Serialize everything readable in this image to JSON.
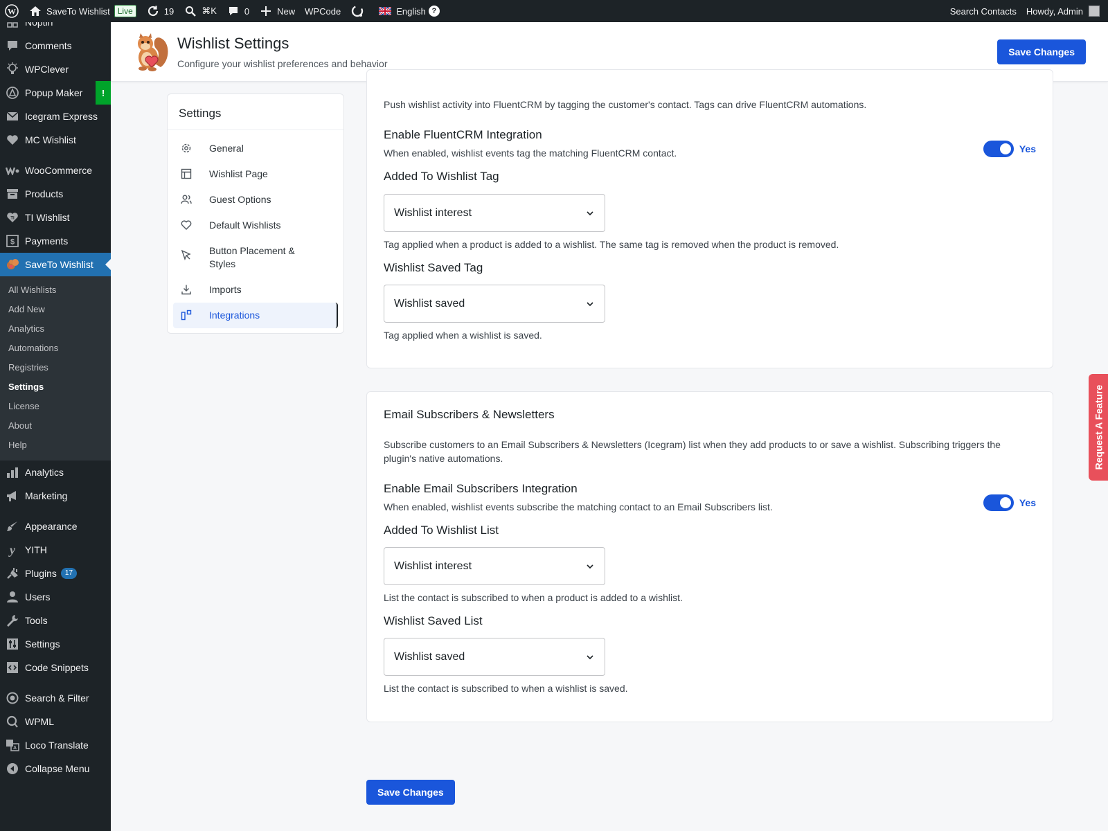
{
  "adminbar": {
    "site_name": "SaveTo Wishlist",
    "live_label": "Live",
    "updates_count": "19",
    "command_label": "⌘K",
    "comments_count": "0",
    "new_label": "New",
    "wpcode_label": "WPCode",
    "language_label": "English",
    "search_contacts": "Search Contacts",
    "howdy": "Howdy, Admin"
  },
  "sidebar": {
    "top_items": [
      {
        "label": "Noptin",
        "icon": "noptin-icon"
      },
      {
        "label": "Comments",
        "icon": "comment-icon"
      },
      {
        "label": "WPClever",
        "icon": "bulb-icon"
      },
      {
        "label": "Popup Maker",
        "icon": "popup-icon"
      },
      {
        "label": "Icegram Express",
        "icon": "mail-icon"
      },
      {
        "label": "MC Wishlist",
        "icon": "heart-icon"
      },
      {
        "label": "WooCommerce",
        "icon": "woo-icon"
      },
      {
        "label": "Products",
        "icon": "archive-icon"
      },
      {
        "label": "TI Wishlist",
        "icon": "ti-heart-icon"
      },
      {
        "label": "Payments",
        "icon": "dollar-icon"
      },
      {
        "label": "SaveTo Wishlist",
        "icon": "squirrel-icon"
      }
    ],
    "popup_alert": "!",
    "submenu": [
      "All Wishlists",
      "Add New",
      "Analytics",
      "Automations",
      "Registries",
      "Settings",
      "License",
      "About",
      "Help"
    ],
    "bottom_items": [
      {
        "label": "Analytics",
        "icon": "bar-chart-icon"
      },
      {
        "label": "Marketing",
        "icon": "megaphone-icon"
      },
      {
        "label": "Appearance",
        "icon": "brush-icon"
      },
      {
        "label": "YITH",
        "icon": "yith-icon"
      },
      {
        "label": "Plugins",
        "icon": "plug-icon"
      },
      {
        "label": "Users",
        "icon": "user-icon"
      },
      {
        "label": "Tools",
        "icon": "wrench-icon"
      },
      {
        "label": "Settings",
        "icon": "sliders-icon"
      },
      {
        "label": "Code Snippets",
        "icon": "code-icon"
      },
      {
        "label": "Search & Filter",
        "icon": "filter-icon"
      },
      {
        "label": "WPML",
        "icon": "wpml-icon"
      },
      {
        "label": "Loco Translate",
        "icon": "translate-icon"
      },
      {
        "label": "Collapse Menu",
        "icon": "collapse-icon"
      }
    ],
    "plugins_count": "17"
  },
  "header": {
    "title": "Wishlist Settings",
    "subtitle": "Configure your wishlist preferences and behavior",
    "save_label": "Save Changes"
  },
  "settings_nav": {
    "title": "Settings",
    "items": [
      "General",
      "Wishlist Page",
      "Guest Options",
      "Default Wishlists",
      "Button Placement & Styles",
      "Imports",
      "Integrations"
    ]
  },
  "fluentcrm": {
    "description": "Push wishlist activity into FluentCRM by tagging the customer's contact. Tags can drive FluentCRM automations.",
    "enable_title": "Enable FluentCRM Integration",
    "enable_desc": "When enabled, wishlist events tag the matching FluentCRM contact.",
    "toggle_label": "Yes",
    "added_title": "Added To Wishlist Tag",
    "added_value": "Wishlist interest",
    "added_help": "Tag applied when a product is added to a wishlist. The same tag is removed when the product is removed.",
    "saved_title": "Wishlist Saved Tag",
    "saved_value": "Wishlist saved",
    "saved_help": "Tag applied when a wishlist is saved."
  },
  "icegram": {
    "title": "Email Subscribers & Newsletters",
    "description": "Subscribe customers to an Email Subscribers & Newsletters (Icegram) list when they add products to or save a wishlist. Subscribing triggers the plugin's native automations.",
    "enable_title": "Enable Email Subscribers Integration",
    "enable_desc": "When enabled, wishlist events subscribe the matching contact to an Email Subscribers list.",
    "toggle_label": "Yes",
    "added_title": "Added To Wishlist List",
    "added_value": "Wishlist interest",
    "added_help": "List the contact is subscribed to when a product is added to a wishlist.",
    "saved_title": "Wishlist Saved List",
    "saved_value": "Wishlist saved",
    "saved_help": "List the contact is subscribed to when a wishlist is saved."
  },
  "footer": {
    "save_label": "Save Changes"
  },
  "request_feature": "Request A Feature",
  "colors": {
    "primary": "#1a56db",
    "admin_dark": "#1d2327",
    "active_menu": "#2271b1",
    "request_feature": "#e8505b"
  }
}
